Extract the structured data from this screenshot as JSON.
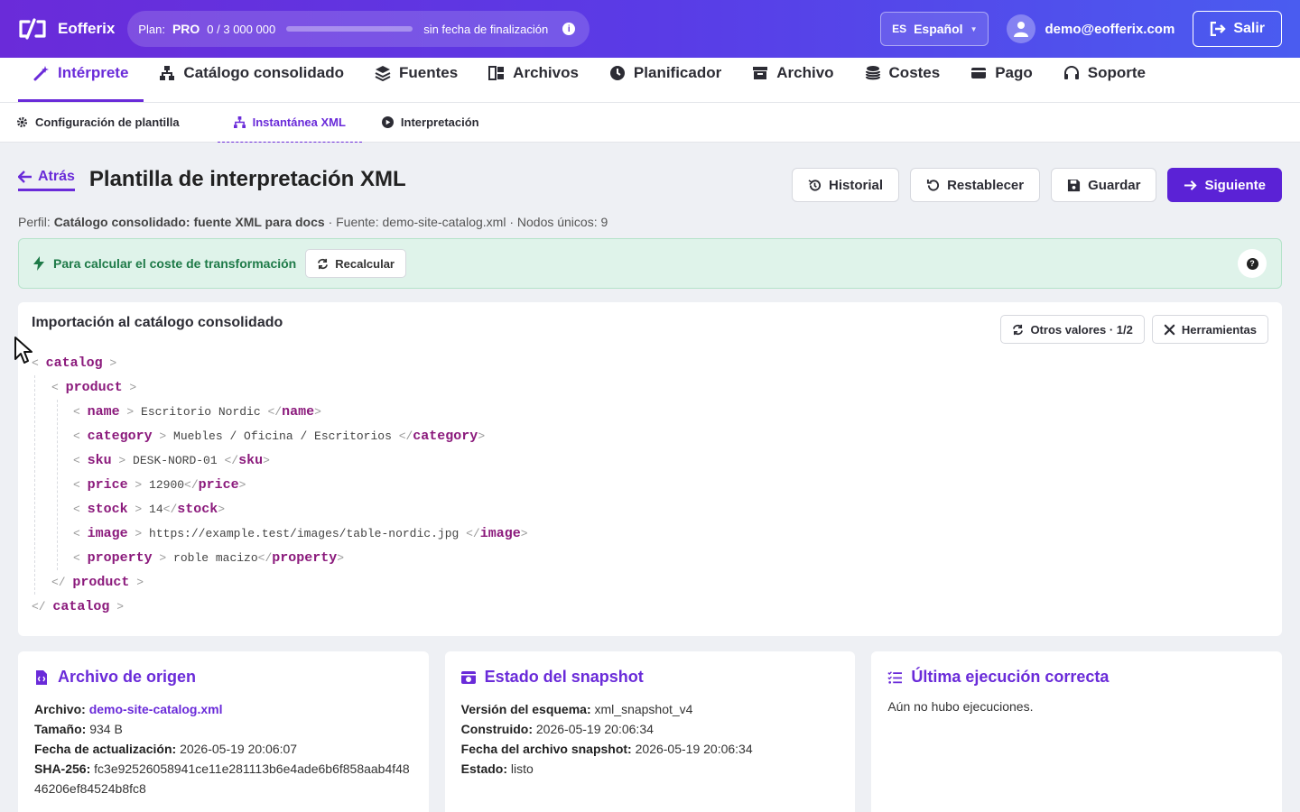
{
  "brand": {
    "name": "Eofferix"
  },
  "plan": {
    "label": "Plan:",
    "tier": "PRO",
    "usage": "0 / 3 000 000",
    "usage_fraction": 0.0,
    "expiry": "sin fecha de finalización"
  },
  "language": {
    "code": "ES",
    "name": "Español"
  },
  "user": {
    "email": "demo@eofferix.com"
  },
  "logout_label": "Salir",
  "main_nav": [
    {
      "label": "Intérprete",
      "icon": "magic-wand-icon",
      "active": true
    },
    {
      "label": "Catálogo consolidado",
      "icon": "network-icon"
    },
    {
      "label": "Fuentes",
      "icon": "layers-icon"
    },
    {
      "label": "Archivos",
      "icon": "grid-icon"
    },
    {
      "label": "Planificador",
      "icon": "clock-icon"
    },
    {
      "label": "Archivo",
      "icon": "archive-icon"
    },
    {
      "label": "Costes",
      "icon": "coins-icon"
    },
    {
      "label": "Pago",
      "icon": "credit-card-icon"
    },
    {
      "label": "Soporte",
      "icon": "headset-icon"
    }
  ],
  "sub_nav": [
    {
      "label": "Configuración de plantilla",
      "icon": "gear-icon"
    },
    {
      "label": "Instantánea XML",
      "icon": "sitemap-icon",
      "active": true
    },
    {
      "label": "Interpretación",
      "icon": "play-icon"
    }
  ],
  "header": {
    "back_label": "Atrás",
    "title": "Plantilla de interpretación XML",
    "actions": {
      "history": "Historial",
      "reset": "Restablecer",
      "save": "Guardar",
      "next": "Siguiente"
    }
  },
  "meta": {
    "profile_label": "Perfil:",
    "profile": "Catálogo consolidado: fuente XML para docs",
    "source_label": "· Fuente:",
    "source": "demo-site-catalog.xml",
    "nodes_label": "· Nodos únicos:",
    "nodes": "9"
  },
  "cost_alert": {
    "label": "Para calcular el coste de transformación",
    "button": "Recalcular",
    "help": "?"
  },
  "xml_card": {
    "title": "Importación al catálogo consolidado",
    "other_values": "Otros valores · 1/2",
    "tools": "Herramientas",
    "root": "catalog",
    "item": "product",
    "fields": [
      {
        "tag": "name",
        "value": " Escritorio Nordic "
      },
      {
        "tag": "category",
        "value": " Muebles / Oficina / Escritorios "
      },
      {
        "tag": "sku",
        "value": " DESK-NORD-01 "
      },
      {
        "tag": "price",
        "value": " 12900"
      },
      {
        "tag": "stock",
        "value": " 14"
      },
      {
        "tag": "image",
        "value": " https://example.test/images/table-nordic.jpg "
      },
      {
        "tag": "property",
        "value": " roble macizo"
      }
    ]
  },
  "cards": {
    "source_file": {
      "title": "Archivo de origen",
      "file_label": "Archivo:",
      "file": "demo-site-catalog.xml",
      "size_label": "Tamaño:",
      "size": "934 B",
      "updated_label": "Fecha de actualización:",
      "updated": "2026-05-19 20:06:07",
      "sha_label": "SHA-256:",
      "sha": "fc3e92526058941ce11e281113b6e4ade6b6f858aab4f4846206ef84524b8fc8"
    },
    "snapshot": {
      "title": "Estado del snapshot",
      "schema_label": "Versión del esquema:",
      "schema": "xml_snapshot_v4",
      "built_label": "Construido:",
      "built": "2026-05-19 20:06:34",
      "file_date_label": "Fecha del archivo snapshot:",
      "file_date": "2026-05-19 20:06:34",
      "status_label": "Estado:",
      "status": "listo"
    },
    "last_run": {
      "title": "Última ejecución correcta",
      "empty": "Aún no hubo ejecuciones."
    }
  },
  "colors": {
    "accent": "#6a2bd9",
    "primary_button": "#5b22d6",
    "alert_bg": "#dff3ea",
    "alert_text": "#1e7a48",
    "xml_tag": "#8b1a7c"
  }
}
